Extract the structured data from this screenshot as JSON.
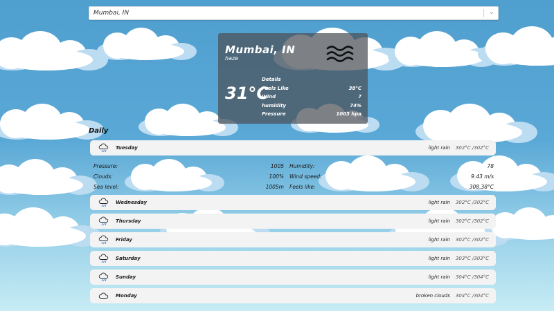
{
  "search": {
    "value": "Mumbai, IN"
  },
  "current": {
    "city": "Mumbai, IN",
    "description": "haze",
    "icon": "wind-icon",
    "temperature": "31°C",
    "details_title": "Details",
    "details": [
      {
        "label": "Feels Like",
        "value": "38°C"
      },
      {
        "label": "Wind",
        "value": "7"
      },
      {
        "label": "humidity",
        "value": "74%"
      },
      {
        "label": "Pressure",
        "value": "1003 hpa"
      }
    ]
  },
  "daily_title": "Daily",
  "days": [
    {
      "day": "Tuesday",
      "icon": "rain-cloud-icon",
      "condition": "light rain",
      "temps": "302°C /302°C"
    },
    {
      "day": "Wednesday",
      "icon": "rain-cloud-icon",
      "condition": "light rain",
      "temps": "302°C /302°C"
    },
    {
      "day": "Thursday",
      "icon": "rain-cloud-icon",
      "condition": "light rain",
      "temps": "302°C /302°C"
    },
    {
      "day": "Friday",
      "icon": "rain-cloud-icon",
      "condition": "light rain",
      "temps": "302°C /302°C"
    },
    {
      "day": "Saturday",
      "icon": "rain-cloud-icon",
      "condition": "light rain",
      "temps": "303°C /303°C"
    },
    {
      "day": "Sunday",
      "icon": "rain-cloud-icon",
      "condition": "light rain",
      "temps": "304°C /304°C"
    },
    {
      "day": "Monday",
      "icon": "cloud-icon",
      "condition": "broken clouds",
      "temps": "304°C /304°C"
    }
  ],
  "expanded": {
    "rows": [
      {
        "l_label": "Pressure:",
        "l_value": "1005",
        "r_label": "Humidity:",
        "r_value": "78"
      },
      {
        "l_label": "Clouds:",
        "l_value": "100%",
        "r_label": "Wind speed:",
        "r_value": "9.43 m/s"
      },
      {
        "l_label": "Sea level:",
        "l_value": "1005m",
        "r_label": "Feels like:",
        "r_value": "308.38°C"
      }
    ]
  }
}
